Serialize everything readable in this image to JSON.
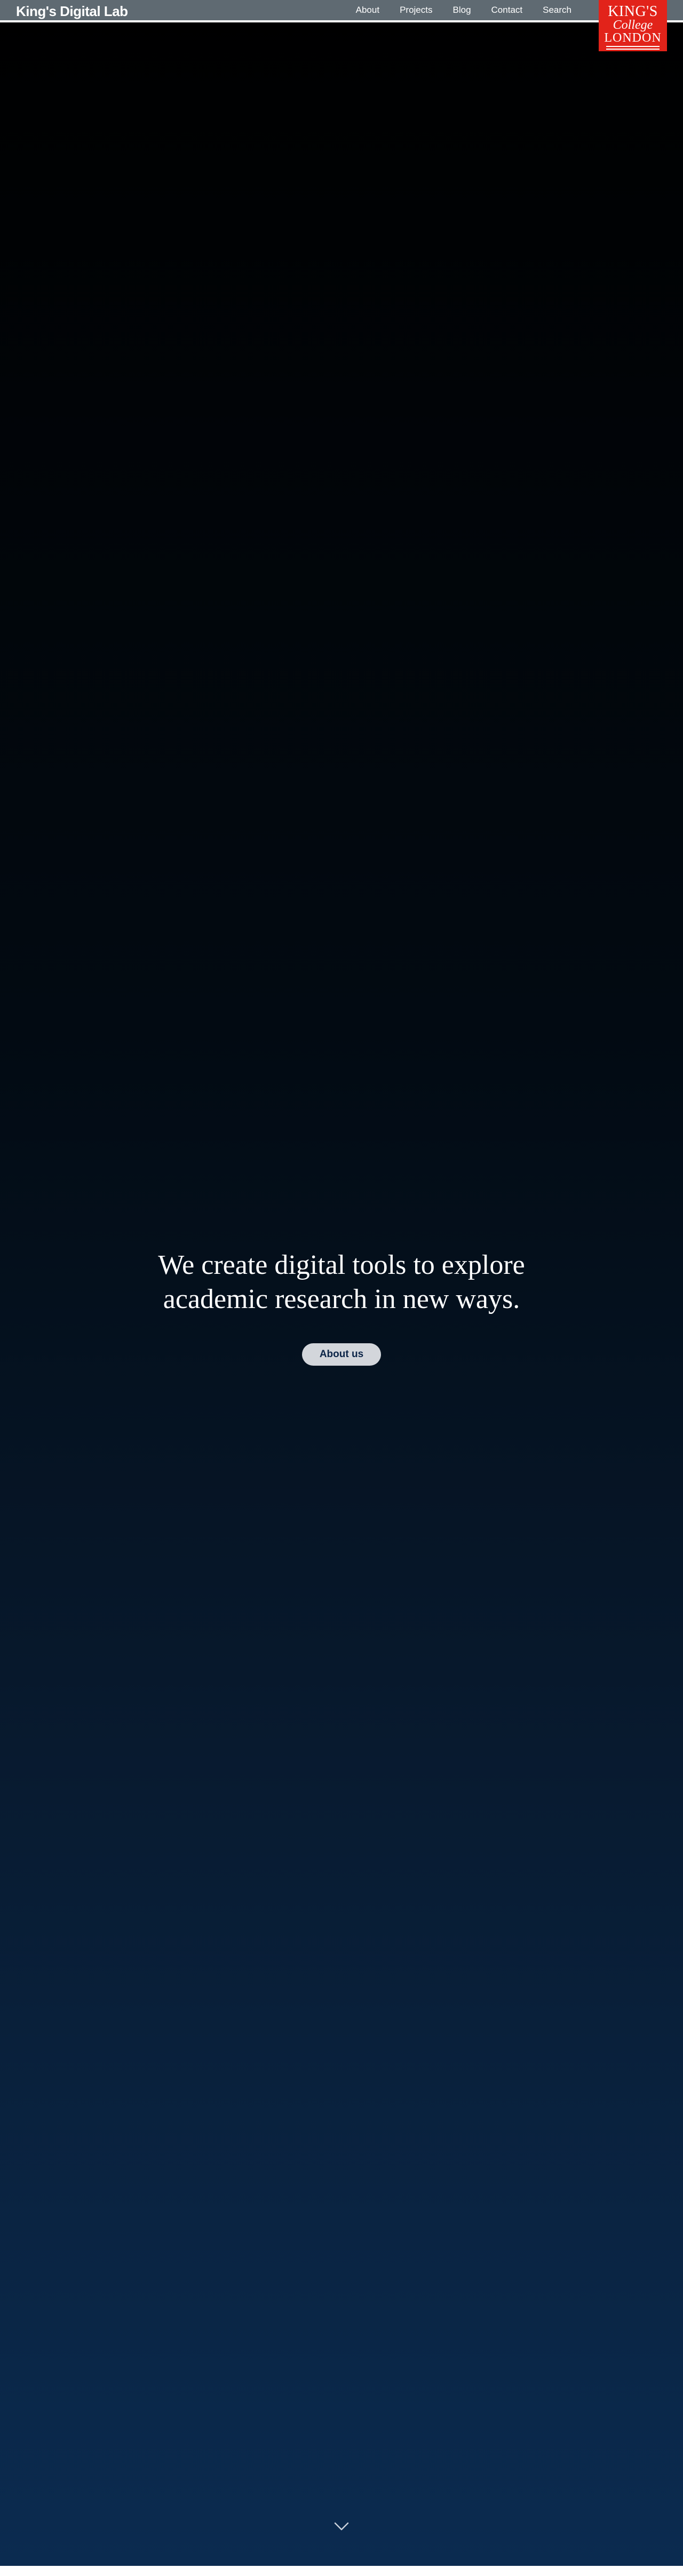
{
  "header": {
    "site_title": "King's Digital Lab",
    "nav": [
      {
        "label": "About"
      },
      {
        "label": "Projects"
      },
      {
        "label": "Blog"
      },
      {
        "label": "Contact"
      },
      {
        "label": "Search"
      }
    ]
  },
  "logo": {
    "line1": "KING'S",
    "line2": "College",
    "line3": "LONDON"
  },
  "hero": {
    "tagline": "We create digital tools to explore academic research in new ways.",
    "cta_label": "About us",
    "scroll_icon": "chevron-down-icon"
  },
  "colors": {
    "nav_bg": "#5f6a72",
    "logo_red": "#e2231a",
    "hero_top": "#000000",
    "hero_bottom": "#0b2b50",
    "button_bg": "#d3d6db",
    "button_text": "#0b2447"
  }
}
